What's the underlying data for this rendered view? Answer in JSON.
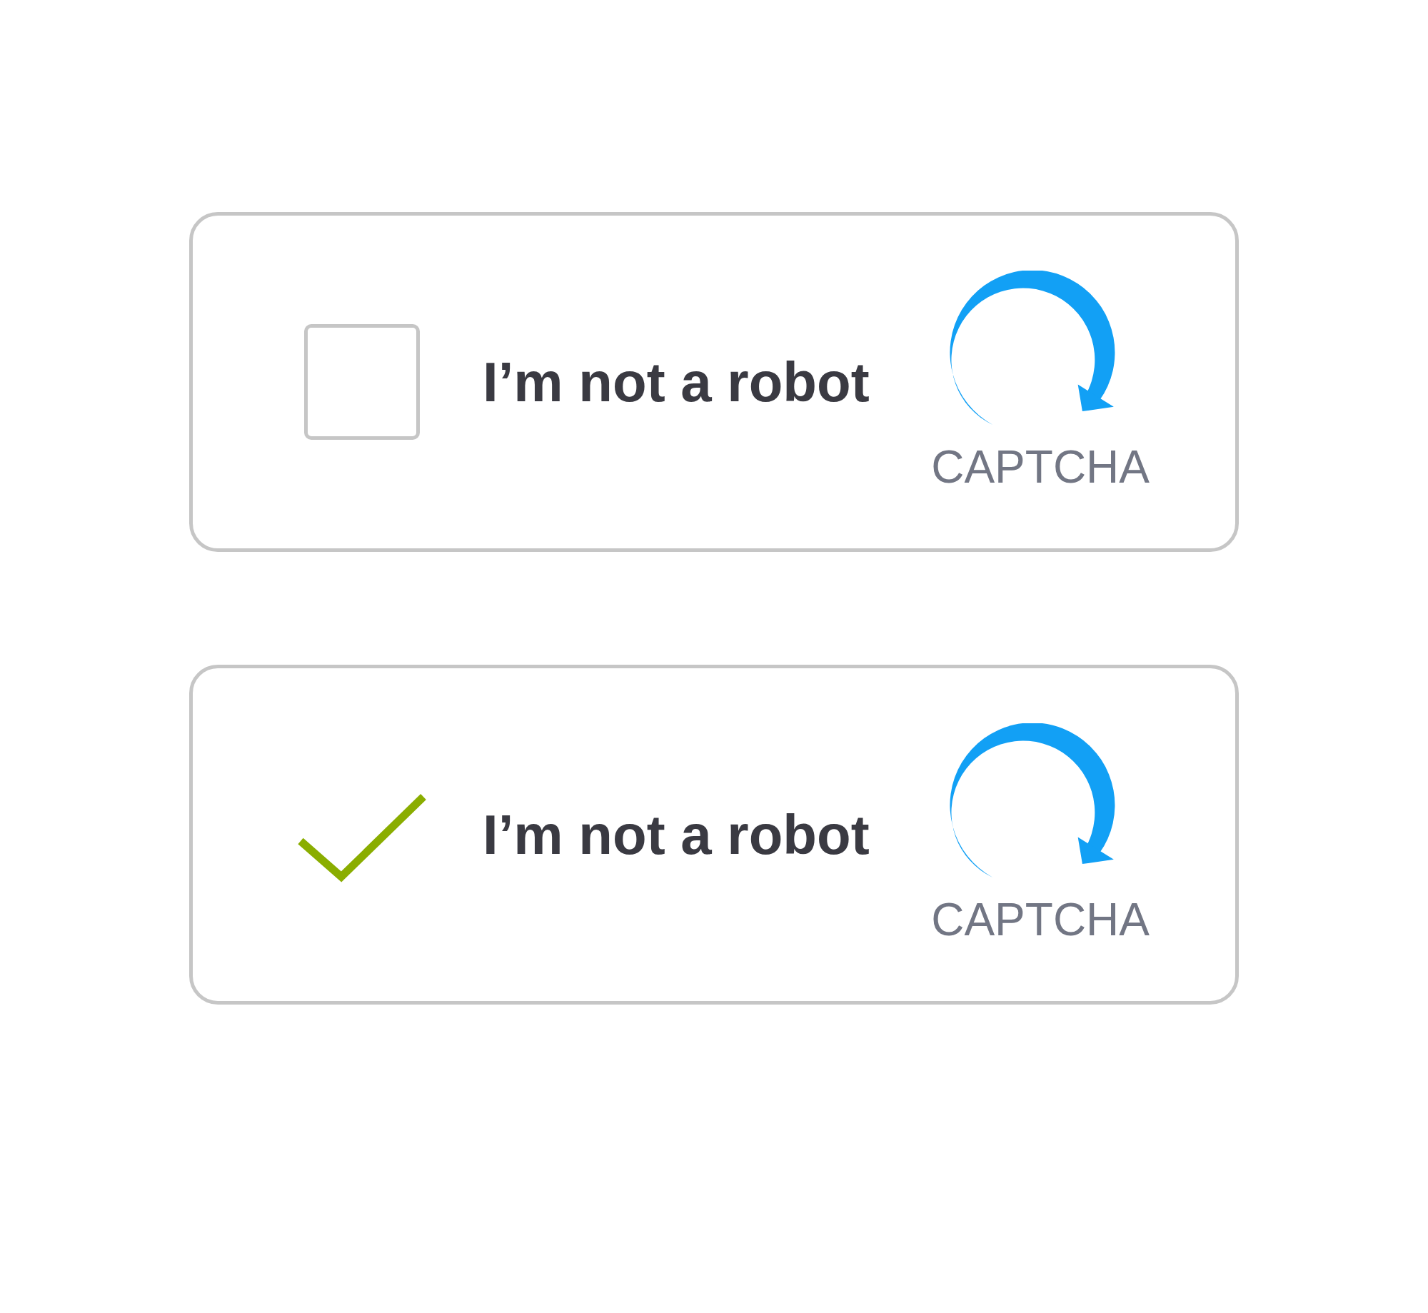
{
  "widgets": [
    {
      "checked": false,
      "label": "I’m not a robot",
      "brand": "CAPTCHA"
    },
    {
      "checked": true,
      "label": "I’m not a robot",
      "brand": "CAPTCHA"
    }
  ]
}
